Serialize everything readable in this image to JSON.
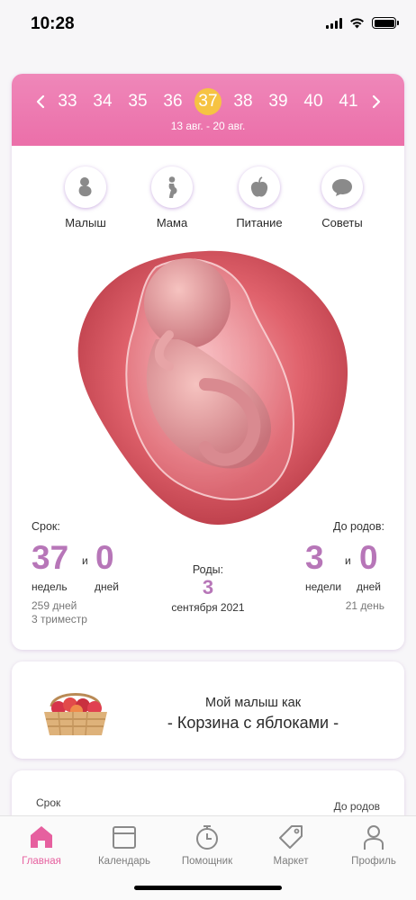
{
  "status_bar": {
    "time": "10:28"
  },
  "week_selector": {
    "weeks": [
      "33",
      "34",
      "35",
      "36",
      "37",
      "38",
      "39",
      "40",
      "41"
    ],
    "active_week": "37",
    "date_range": "13 авг. - 20 авг."
  },
  "categories": [
    {
      "label": "Малыш",
      "icon": "baby-icon"
    },
    {
      "label": "Мама",
      "icon": "pregnant-mom-icon"
    },
    {
      "label": "Питание",
      "icon": "apple-icon"
    },
    {
      "label": "Советы",
      "icon": "chat-bubble-icon"
    }
  ],
  "stats": {
    "term_label": "Срок:",
    "weeks_value": "37",
    "and_1": "и",
    "days_value": "0",
    "weeks_unit": "недель",
    "days_unit": "дней",
    "total_days": "259 дней",
    "trimester": "3 триместр",
    "birth_label": "Роды:",
    "birth_day": "3",
    "birth_month_year": "сентября 2021",
    "until_label": "До родов:",
    "until_weeks": "3",
    "and_2": "и",
    "until_days": "0",
    "until_weeks_unit": "недели",
    "until_days_unit": "дней",
    "until_total": "21 день"
  },
  "size_card": {
    "line1": "Мой малыш как",
    "line2": "- Корзина с яблоками -"
  },
  "third_card": {
    "left": "Срок",
    "right": "До родов"
  },
  "tabs": [
    {
      "label": "Главная",
      "icon": "home-icon",
      "active": true
    },
    {
      "label": "Календарь",
      "icon": "calendar-icon",
      "active": false
    },
    {
      "label": "Помощник",
      "icon": "stopwatch-icon",
      "active": false
    },
    {
      "label": "Маркет",
      "icon": "tag-icon",
      "active": false
    },
    {
      "label": "Профиль",
      "icon": "person-icon",
      "active": false
    }
  ],
  "colors": {
    "accent_pink": "#eb6fa9",
    "active_week": "#f6c343",
    "number_purple": "#b776b8",
    "icon_grey": "#7d7d7d"
  }
}
